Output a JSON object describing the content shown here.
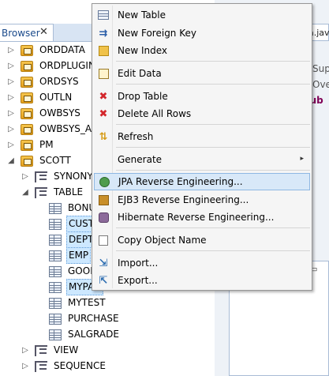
{
  "browser_tab": {
    "label": "Browser",
    "close": "✕"
  },
  "tree": {
    "items": [
      {
        "label": "ORDDATA",
        "expander": "▷",
        "icon": "schema"
      },
      {
        "label": "ORDPLUGINS",
        "expander": "▷",
        "icon": "schema"
      },
      {
        "label": "ORDSYS",
        "expander": "▷",
        "icon": "schema"
      },
      {
        "label": "OUTLN",
        "expander": "▷",
        "icon": "schema"
      },
      {
        "label": "OWBSYS",
        "expander": "▷",
        "icon": "schema"
      },
      {
        "label": "OWBSYS_AU",
        "expander": "▷",
        "icon": "schema"
      },
      {
        "label": "PM",
        "expander": "▷",
        "icon": "schema"
      },
      {
        "label": "SCOTT",
        "expander": "◢",
        "icon": "schema"
      },
      {
        "label": "SYNONYM",
        "expander": "▷",
        "icon": "folder"
      },
      {
        "label": "TABLE",
        "expander": "◢",
        "icon": "folder"
      },
      {
        "label": "BONU",
        "expander": "",
        "icon": "table"
      },
      {
        "label": "CUSTO",
        "expander": "",
        "icon": "table",
        "selected": true
      },
      {
        "label": "DEPT",
        "expander": "",
        "icon": "table",
        "selected": true
      },
      {
        "label": "EMP",
        "expander": "",
        "icon": "table",
        "selected": true
      },
      {
        "label": "GOOD",
        "expander": "",
        "icon": "table"
      },
      {
        "label": "MYPAR",
        "expander": "",
        "icon": "table",
        "selected": true
      },
      {
        "label": "MYTEST",
        "expander": "",
        "icon": "table"
      },
      {
        "label": "PURCHASE",
        "expander": "",
        "icon": "table"
      },
      {
        "label": "SALGRADE",
        "expander": "",
        "icon": "table"
      },
      {
        "label": "VIEW",
        "expander": "▷",
        "icon": "folder"
      },
      {
        "label": "SEQUENCE",
        "expander": "▷",
        "icon": "folder"
      }
    ]
  },
  "editor": {
    "tab_label": "a.jav",
    "code_lines": [
      "@Sup",
      "@Ove",
      "pub"
    ],
    "bottom_tab": "▭"
  },
  "context_menu": {
    "items": [
      {
        "label": "New Table",
        "icon": "table-icon"
      },
      {
        "label": "New Foreign Key",
        "icon": "foreign-key-icon"
      },
      {
        "label": "New Index",
        "icon": "index-icon"
      },
      {
        "label": "Edit Data",
        "icon": "edit-data-icon"
      },
      {
        "label": "Drop Table",
        "icon": "drop-icon"
      },
      {
        "label": "Delete All Rows",
        "icon": "delete-icon"
      },
      {
        "label": "Refresh",
        "icon": "refresh-icon"
      },
      {
        "label": "Generate",
        "icon": "",
        "submenu": "▸"
      },
      {
        "label": "JPA Reverse Engineering...",
        "icon": "jpa-icon",
        "highlighted": true
      },
      {
        "label": "EJB3 Reverse Engineering...",
        "icon": "ejb3-icon"
      },
      {
        "label": "Hibernate Reverse Engineering...",
        "icon": "hibernate-icon"
      },
      {
        "label": "Copy Object Name",
        "icon": "copy-icon"
      },
      {
        "label": "Import...",
        "icon": "import-icon"
      },
      {
        "label": "Export...",
        "icon": "export-icon"
      }
    ]
  }
}
